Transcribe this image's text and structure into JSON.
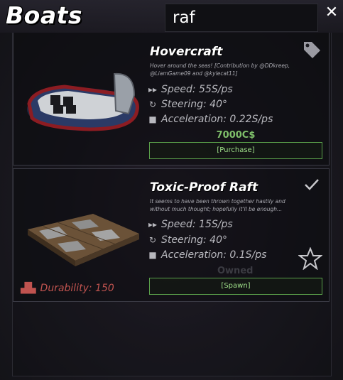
{
  "header": {
    "title": "Boats"
  },
  "search": {
    "value": "raf"
  },
  "close_label": "✕",
  "boats": [
    {
      "name": "Hovercraft",
      "description": "Hover around the seas! [Contribution by @DDkreep, @LiamGame09 and @kylecat11]",
      "speed": "Speed: 55S/ps",
      "steering": "Steering: 40°",
      "acceleration": "Acceleration: 0.22S/ps",
      "price": "7000C$",
      "action": "[Purchase]",
      "corner_icon": "price-tag-icon"
    },
    {
      "name": "Toxic-Proof Raft",
      "description": "It seems to have been thrown together hastily and without much thought; hopefully it'll be enough...",
      "speed": "Speed: 15S/ps",
      "steering": "Steering: 40°",
      "acceleration": "Acceleration: 0.1S/ps",
      "status": "Owned",
      "durability": "Durability: 150",
      "action": "[Spawn]",
      "corner_icon": "checkmark-icon",
      "favorite_icon": "star-outline-icon"
    }
  ],
  "colors": {
    "accent_green": "#9fe08a",
    "price_green": "#7fbf6a",
    "durability_red": "#c0534f"
  }
}
